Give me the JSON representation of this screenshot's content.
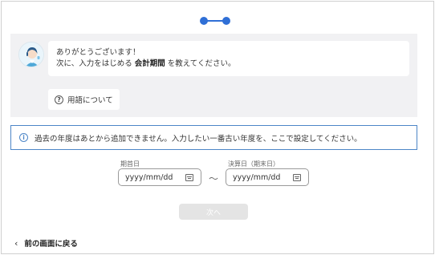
{
  "stepper": {
    "total_steps": 2,
    "current_step": 1,
    "color": "#2f6fd6"
  },
  "chat": {
    "line1": "ありがとうございます！",
    "line2_prefix": "次に、入力をはじめる ",
    "line2_bold": "会計期間",
    "line2_suffix": " を教えてください。",
    "glossary_button": "用語について",
    "glossary_icon": "question-circle-icon",
    "avatar_icon": "assistant-avatar-icon"
  },
  "notice": {
    "icon": "info-circle-icon",
    "text": "過去の年度はあとから追加できません。入力したい一番古い年度を、ここで設定してください。",
    "border_color": "#4d86c7"
  },
  "period": {
    "start_label": "期首日",
    "start_placeholder": "yyyy/mm/dd",
    "separator": "～",
    "end_label": "決算日（期末日）",
    "end_placeholder": "yyyy/mm/dd",
    "calendar_icon": "calendar-icon"
  },
  "actions": {
    "next_label": "次へ",
    "next_disabled": true,
    "back_label": "前の画面に戻る",
    "back_icon": "chevron-left-icon"
  }
}
